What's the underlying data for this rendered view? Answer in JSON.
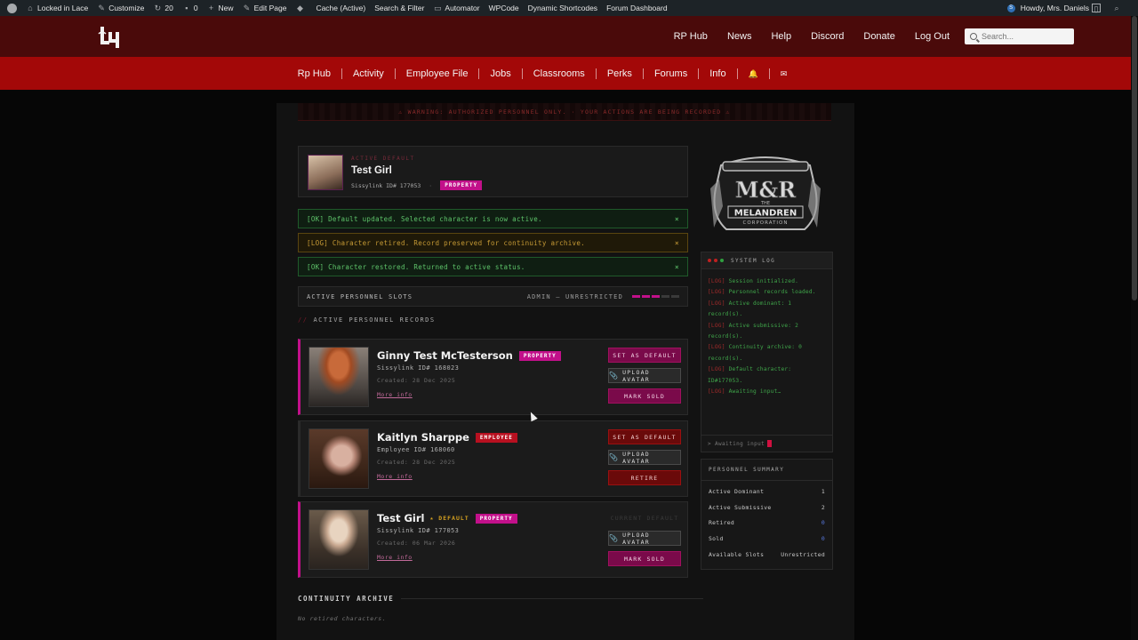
{
  "adminbar": {
    "site": "Locked in Lace",
    "customize": "Customize",
    "updates": "20",
    "comments": "0",
    "new": "New",
    "edit_page": "Edit Page",
    "cache": "Cache (Active)",
    "search_filter": "Search & Filter",
    "automator": "Automator",
    "wpcode": "WPCode",
    "dynamic_shortcodes": "Dynamic Shortcodes",
    "forum_dashboard": "Forum Dashboard",
    "howdy": "Howdy, Mrs. Daniels",
    "avatar_letter": "S"
  },
  "header": {
    "nav": [
      "RP Hub",
      "News",
      "Help",
      "Discord",
      "Donate",
      "Log Out"
    ],
    "search_placeholder": "Search..."
  },
  "subnav": [
    "Rp Hub",
    "Activity",
    "Employee File",
    "Jobs",
    "Classrooms",
    "Perks",
    "Forums",
    "Info",
    "🔔",
    "✉"
  ],
  "warning": "⚠ WARNING: AUTHORIZED PERSONNEL ONLY. · YOUR ACTIONS ARE BEING RECORDED ⚠",
  "active_default": {
    "label": "ACTIVE DEFAULT",
    "name": "Test Girl",
    "id": "Sissylink ID# 177053",
    "sep": "·",
    "badge": "PROPERTY"
  },
  "alerts": [
    {
      "text": "[OK] Default updated. Selected character is now active.",
      "type": "ok"
    },
    {
      "text": "[LOG] Character retired. Record preserved for continuity archive.",
      "type": "log"
    },
    {
      "text": "[OK] Character restored. Returned to active status.",
      "type": "ok"
    }
  ],
  "close_glyph": "×",
  "slots": {
    "label": "ACTIVE PERSONNEL SLOTS",
    "mode": "ADMIN — UNRESTRICTED"
  },
  "records_title": {
    "slashes": "//",
    "text": "ACTIVE PERSONNEL RECORDS"
  },
  "cards": [
    {
      "name": "Ginny Test McTesterson",
      "badge": "PROPERTY",
      "id": "Sissylink ID# 168023",
      "created": "Created: 28 Dec 2025",
      "more": "More info",
      "btn1": "SET AS DEFAULT",
      "btn2": "UPLOAD AVATAR",
      "btn3": "MARK SOLD"
    },
    {
      "name": "Kaitlyn Sharppe",
      "badge": "EMPLOYEE",
      "id": "Employee ID# 168060",
      "created": "Created: 28 Dec 2025",
      "more": "More info",
      "btn1": "SET AS DEFAULT",
      "btn2": "UPLOAD AVATAR",
      "btn3": "RETIRE"
    },
    {
      "name": "Test Girl",
      "default_tag": "★ DEFAULT",
      "badge": "PROPERTY",
      "id": "Sissylink ID# 177053",
      "created": "Created: 06 Mar 2026",
      "more": "More info",
      "btn1": "CURRENT DEFAULT",
      "btn2": "UPLOAD AVATAR",
      "btn3": "MARK SOLD"
    }
  ],
  "clip_glyph": "📎",
  "archive": {
    "title": "CONTINUITY ARCHIVE",
    "empty": "No retired characters."
  },
  "brand": {
    "top": "M&R",
    "mid": "THE",
    "name": "MELANDREN",
    "sub": "CORPORATION"
  },
  "syslog": {
    "title": "SYSTEM LOG",
    "tag": "[LOG]",
    "lines": [
      "Session initialized.",
      "Personnel records loaded.",
      "Active dominant: 1 record(s).",
      "Active submissive: 2 record(s).",
      "Continuity archive: 0 record(s).",
      "Default character: ID#177053.",
      "Awaiting input…"
    ],
    "await": "> Awaiting input"
  },
  "summary": {
    "title": "PERSONNEL SUMMARY",
    "rows": [
      {
        "k": "Active Dominant",
        "v": "1"
      },
      {
        "k": "Active Submissive",
        "v": "2"
      },
      {
        "k": "Retired",
        "v": "0"
      },
      {
        "k": "Sold",
        "v": "0"
      },
      {
        "k": "Available Slots",
        "v": "Unrestricted"
      }
    ]
  },
  "colors": {
    "property": "#c2108a",
    "employee": "#b81020",
    "header": "#4a0a0a",
    "subnav": "#a30808"
  }
}
